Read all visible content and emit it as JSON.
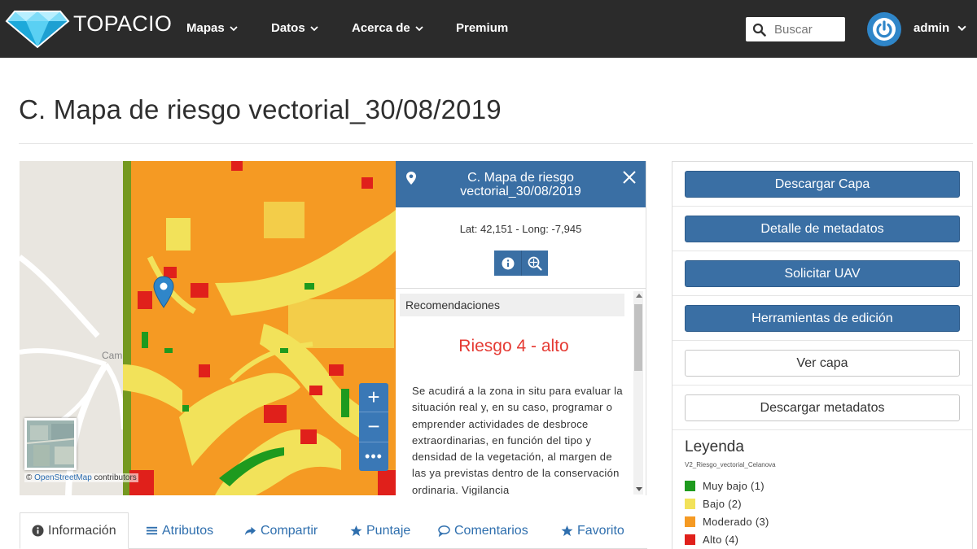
{
  "app": {
    "brand": "TOPACIO"
  },
  "nav": {
    "items": [
      {
        "label": "Mapas",
        "dropdown": true
      },
      {
        "label": "Datos",
        "dropdown": true
      },
      {
        "label": "Acerca de",
        "dropdown": true
      },
      {
        "label": "Premium",
        "dropdown": false
      }
    ],
    "search_placeholder": "Buscar",
    "user": "admin"
  },
  "page": {
    "title": "C. Mapa de riesgo vectorial_30/08/2019"
  },
  "map": {
    "place_label": "Cam",
    "attribution_link": "OpenStreetMap",
    "attribution_rest": " contributors",
    "attribution_symbol": "©",
    "zoom_in": "+",
    "zoom_out": "−",
    "more": "•••"
  },
  "popup": {
    "title": "C. Mapa de riesgo vectorial_30/08/2019",
    "latlong": "Lat: 42,151 - Long: -7,945",
    "section_title": "Recomendaciones",
    "risk": "Riesgo 4 - alto",
    "text": "Se acudirá a la zona in situ para evaluar la situación real y, en su caso, programar o emprender actividades de desbroce extraordinarias, en función del tipo y densidad de la vegetación, al margen de las ya previstas dentro de la conservación ordinaria. Vigilancia"
  },
  "tabs": [
    {
      "label": "Información",
      "icon": "info-icon",
      "active": true
    },
    {
      "label": "Atributos",
      "icon": "list-icon",
      "active": false
    },
    {
      "label": "Compartir",
      "icon": "share-icon",
      "active": false
    },
    {
      "label": "Puntaje",
      "icon": "star-icon",
      "active": false
    },
    {
      "label": "Comentarios",
      "icon": "comment-icon",
      "active": false
    },
    {
      "label": "Favorito",
      "icon": "star-icon",
      "active": false
    }
  ],
  "side": {
    "buttons": [
      {
        "label": "Descargar Capa",
        "style": "primary"
      },
      {
        "label": "Detalle de metadatos",
        "style": "primary"
      },
      {
        "label": "Solicitar UAV",
        "style": "primary"
      },
      {
        "label": "Herramientas de edición",
        "style": "primary"
      },
      {
        "label": "Ver capa",
        "style": "outline"
      },
      {
        "label": "Descargar metadatos",
        "style": "outline"
      }
    ],
    "legend": {
      "title": "Leyenda",
      "layer": "V2_Riesgo_vectorial_Celanova",
      "items": [
        {
          "label": "Muy bajo (1)",
          "color": "#1e9a1e"
        },
        {
          "label": "Bajo (2)",
          "color": "#f2e25a"
        },
        {
          "label": "Moderado (3)",
          "color": "#f59a23"
        },
        {
          "label": "Alto (4)",
          "color": "#e0201b"
        }
      ]
    }
  },
  "colors": {
    "nav_bg": "#2b2b2b",
    "accent": "#3a6fa4",
    "risk": "#e53a33"
  }
}
